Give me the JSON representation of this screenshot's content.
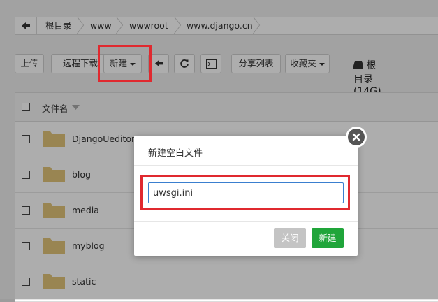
{
  "breadcrumb": {
    "back_icon": "arrow-left-icon",
    "items": [
      "根目录",
      "www",
      "wwwroot",
      "www.django.cn"
    ]
  },
  "toolbar": {
    "upload": "上传",
    "remote_download": "远程下载",
    "new": "新建",
    "share_list": "分享列表",
    "favorites": "收藏夹",
    "disk_label": "根目录(14G)",
    "icons": [
      "arrow-left-icon",
      "refresh-icon",
      "terminal-icon",
      "disk-icon"
    ]
  },
  "table": {
    "header_name": "文件名",
    "rows": [
      "DjangoUeditor",
      "blog",
      "media",
      "myblog",
      "static"
    ]
  },
  "dialog": {
    "title": "新建空白文件",
    "input_value": "uwsgi.ini",
    "close_button": "关闭",
    "create_button": "新建"
  },
  "colors": {
    "primary": "#20a53a",
    "disabled": "#c4c4c4",
    "highlight": "#e0292f",
    "folder": "#e2c57a"
  }
}
